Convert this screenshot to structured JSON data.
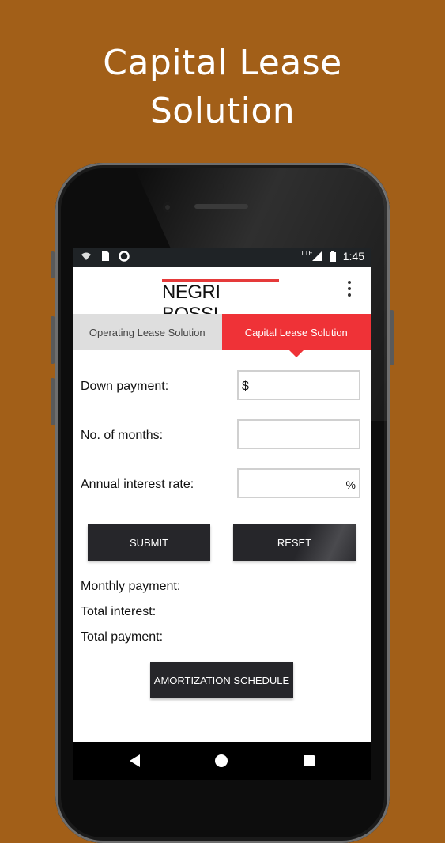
{
  "promo": {
    "line1": "Capital Lease",
    "line2": "Solution"
  },
  "status_bar": {
    "time": "1:45",
    "network": "LTE",
    "icons": [
      "wifi-icon",
      "sd-card-icon",
      "circle-icon",
      "signal-icon",
      "battery-icon"
    ]
  },
  "app_bar": {
    "logo": "NEGRI BOSSI",
    "menu_icon": "overflow-menu-icon"
  },
  "tabs": [
    {
      "label": "Operating Lease Solution",
      "active": false
    },
    {
      "label": "Capital Lease Solution",
      "active": true
    }
  ],
  "form": {
    "down_payment": {
      "label": "Down payment:",
      "prefix": "$",
      "value": ""
    },
    "months": {
      "label": "No. of months:",
      "value": ""
    },
    "interest": {
      "label": "Annual interest rate:",
      "suffix": "%",
      "value": ""
    }
  },
  "buttons": {
    "submit": "SUBMIT",
    "reset": "RESET",
    "amortization": "AMORTIZATION SCHEDULE"
  },
  "results": {
    "monthly": "Monthly payment:",
    "interest": "Total interest:",
    "total": "Total payment:"
  },
  "colors": {
    "background": "#a25f18",
    "accent": "#ef3237",
    "button": "#26262a"
  }
}
